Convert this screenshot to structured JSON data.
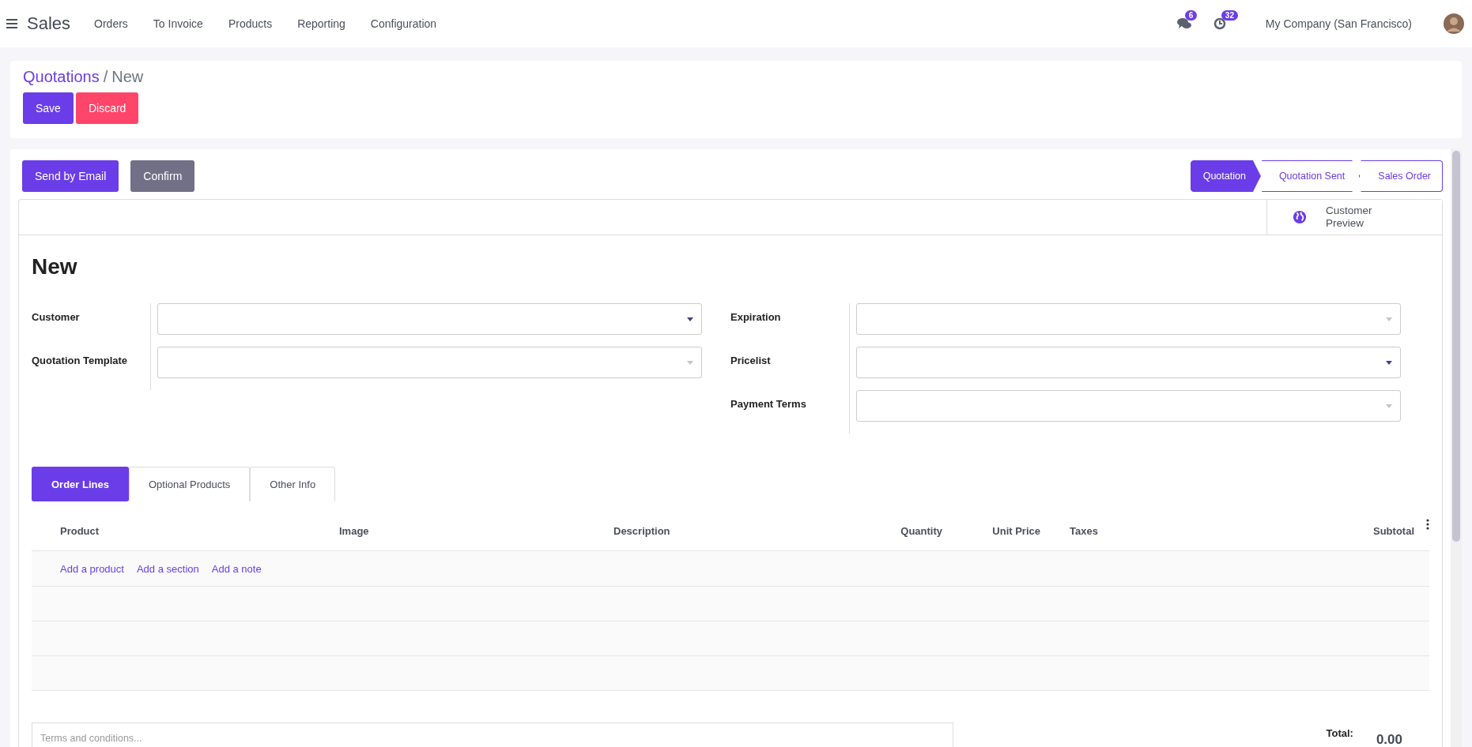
{
  "nav": {
    "app_title": "Sales",
    "menu": [
      "Orders",
      "To Invoice",
      "Products",
      "Reporting",
      "Configuration"
    ],
    "messages_count": "6",
    "activities_count": "32",
    "company": "My Company (San Francisco)"
  },
  "breadcrumb": {
    "parent": "Quotations",
    "separator": "/",
    "current": "New"
  },
  "control_buttons": [
    {
      "label": "Save",
      "kind": "primary"
    },
    {
      "label": "Discard",
      "kind": "danger"
    }
  ],
  "header_buttons": [
    {
      "label": "Send by Email",
      "kind": "primary"
    },
    {
      "label": "Confirm",
      "kind": "secondary"
    }
  ],
  "status_bar": [
    {
      "label": "Quotation",
      "selected": true
    },
    {
      "label": "Quotation Sent",
      "selected": false
    },
    {
      "label": "Sales Order",
      "selected": false
    }
  ],
  "button_box": {
    "label": "Customer Preview"
  },
  "title": "New",
  "left_fields": [
    {
      "label": "Customer",
      "emphasized": true
    },
    {
      "label": "Quotation Template",
      "emphasized": false
    }
  ],
  "right_fields": [
    {
      "label": "Expiration",
      "emphasized": false
    },
    {
      "label": "Pricelist",
      "emphasized": true
    },
    {
      "label": "Payment Terms",
      "emphasized": false
    }
  ],
  "tabs": [
    {
      "label": "Order Lines",
      "selected": true
    },
    {
      "label": "Optional Products",
      "selected": false
    },
    {
      "label": "Other Info",
      "selected": false
    }
  ],
  "table": {
    "columns": [
      "Product",
      "Image",
      "Description",
      "Quantity",
      "Unit Price",
      "Taxes",
      "Subtotal"
    ],
    "add_links": [
      "Add a product",
      "Add a section",
      "Add a note"
    ]
  },
  "notes": {
    "placeholder": "Terms and conditions..."
  },
  "totals": {
    "label": "Total:",
    "value": "0.00"
  }
}
